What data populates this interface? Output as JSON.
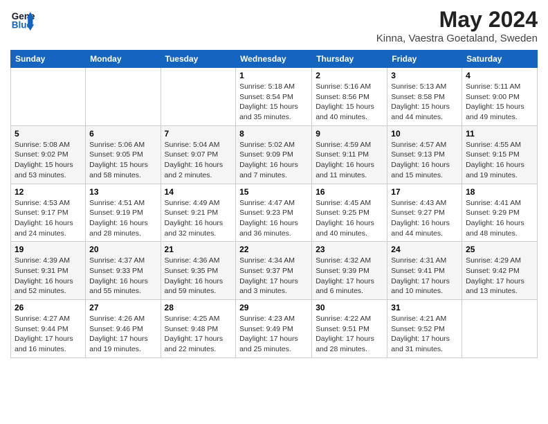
{
  "header": {
    "logo_line1": "General",
    "logo_line2": "Blue",
    "month_title": "May 2024",
    "location": "Kinna, Vaestra Goetaland, Sweden"
  },
  "days_of_week": [
    "Sunday",
    "Monday",
    "Tuesday",
    "Wednesday",
    "Thursday",
    "Friday",
    "Saturday"
  ],
  "weeks": [
    [
      {
        "day": "",
        "info": ""
      },
      {
        "day": "",
        "info": ""
      },
      {
        "day": "",
        "info": ""
      },
      {
        "day": "1",
        "info": "Sunrise: 5:18 AM\nSunset: 8:54 PM\nDaylight: 15 hours and 35 minutes."
      },
      {
        "day": "2",
        "info": "Sunrise: 5:16 AM\nSunset: 8:56 PM\nDaylight: 15 hours and 40 minutes."
      },
      {
        "day": "3",
        "info": "Sunrise: 5:13 AM\nSunset: 8:58 PM\nDaylight: 15 hours and 44 minutes."
      },
      {
        "day": "4",
        "info": "Sunrise: 5:11 AM\nSunset: 9:00 PM\nDaylight: 15 hours and 49 minutes."
      }
    ],
    [
      {
        "day": "5",
        "info": "Sunrise: 5:08 AM\nSunset: 9:02 PM\nDaylight: 15 hours and 53 minutes."
      },
      {
        "day": "6",
        "info": "Sunrise: 5:06 AM\nSunset: 9:05 PM\nDaylight: 15 hours and 58 minutes."
      },
      {
        "day": "7",
        "info": "Sunrise: 5:04 AM\nSunset: 9:07 PM\nDaylight: 16 hours and 2 minutes."
      },
      {
        "day": "8",
        "info": "Sunrise: 5:02 AM\nSunset: 9:09 PM\nDaylight: 16 hours and 7 minutes."
      },
      {
        "day": "9",
        "info": "Sunrise: 4:59 AM\nSunset: 9:11 PM\nDaylight: 16 hours and 11 minutes."
      },
      {
        "day": "10",
        "info": "Sunrise: 4:57 AM\nSunset: 9:13 PM\nDaylight: 16 hours and 15 minutes."
      },
      {
        "day": "11",
        "info": "Sunrise: 4:55 AM\nSunset: 9:15 PM\nDaylight: 16 hours and 19 minutes."
      }
    ],
    [
      {
        "day": "12",
        "info": "Sunrise: 4:53 AM\nSunset: 9:17 PM\nDaylight: 16 hours and 24 minutes."
      },
      {
        "day": "13",
        "info": "Sunrise: 4:51 AM\nSunset: 9:19 PM\nDaylight: 16 hours and 28 minutes."
      },
      {
        "day": "14",
        "info": "Sunrise: 4:49 AM\nSunset: 9:21 PM\nDaylight: 16 hours and 32 minutes."
      },
      {
        "day": "15",
        "info": "Sunrise: 4:47 AM\nSunset: 9:23 PM\nDaylight: 16 hours and 36 minutes."
      },
      {
        "day": "16",
        "info": "Sunrise: 4:45 AM\nSunset: 9:25 PM\nDaylight: 16 hours and 40 minutes."
      },
      {
        "day": "17",
        "info": "Sunrise: 4:43 AM\nSunset: 9:27 PM\nDaylight: 16 hours and 44 minutes."
      },
      {
        "day": "18",
        "info": "Sunrise: 4:41 AM\nSunset: 9:29 PM\nDaylight: 16 hours and 48 minutes."
      }
    ],
    [
      {
        "day": "19",
        "info": "Sunrise: 4:39 AM\nSunset: 9:31 PM\nDaylight: 16 hours and 52 minutes."
      },
      {
        "day": "20",
        "info": "Sunrise: 4:37 AM\nSunset: 9:33 PM\nDaylight: 16 hours and 55 minutes."
      },
      {
        "day": "21",
        "info": "Sunrise: 4:36 AM\nSunset: 9:35 PM\nDaylight: 16 hours and 59 minutes."
      },
      {
        "day": "22",
        "info": "Sunrise: 4:34 AM\nSunset: 9:37 PM\nDaylight: 17 hours and 3 minutes."
      },
      {
        "day": "23",
        "info": "Sunrise: 4:32 AM\nSunset: 9:39 PM\nDaylight: 17 hours and 6 minutes."
      },
      {
        "day": "24",
        "info": "Sunrise: 4:31 AM\nSunset: 9:41 PM\nDaylight: 17 hours and 10 minutes."
      },
      {
        "day": "25",
        "info": "Sunrise: 4:29 AM\nSunset: 9:42 PM\nDaylight: 17 hours and 13 minutes."
      }
    ],
    [
      {
        "day": "26",
        "info": "Sunrise: 4:27 AM\nSunset: 9:44 PM\nDaylight: 17 hours and 16 minutes."
      },
      {
        "day": "27",
        "info": "Sunrise: 4:26 AM\nSunset: 9:46 PM\nDaylight: 17 hours and 19 minutes."
      },
      {
        "day": "28",
        "info": "Sunrise: 4:25 AM\nSunset: 9:48 PM\nDaylight: 17 hours and 22 minutes."
      },
      {
        "day": "29",
        "info": "Sunrise: 4:23 AM\nSunset: 9:49 PM\nDaylight: 17 hours and 25 minutes."
      },
      {
        "day": "30",
        "info": "Sunrise: 4:22 AM\nSunset: 9:51 PM\nDaylight: 17 hours and 28 minutes."
      },
      {
        "day": "31",
        "info": "Sunrise: 4:21 AM\nSunset: 9:52 PM\nDaylight: 17 hours and 31 minutes."
      },
      {
        "day": "",
        "info": ""
      }
    ]
  ]
}
